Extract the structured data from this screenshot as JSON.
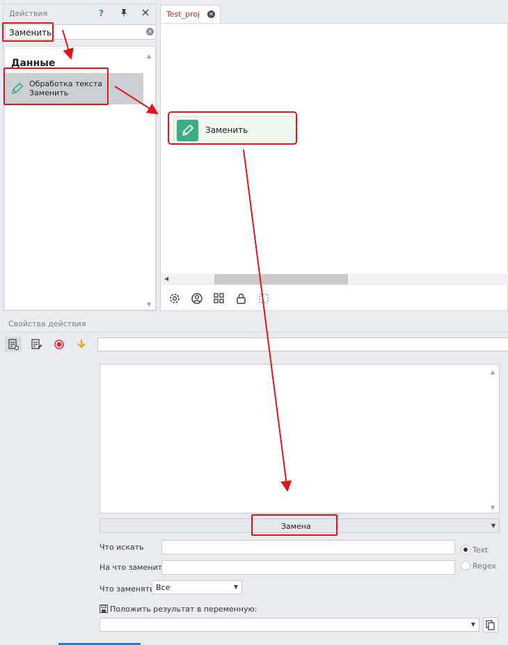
{
  "actions_panel": {
    "title": "Действия",
    "help_icon": "?",
    "search": {
      "value": "Заменить"
    },
    "category": "Данные",
    "item": {
      "line1": "Обработка текста",
      "line2": "Заменить"
    }
  },
  "editor": {
    "tab_label": "Test_proj",
    "node_label": "Заменить",
    "toolbar_icons": [
      "gear-icon",
      "user-circle-icon",
      "grid-icon",
      "lock-icon",
      "selection-icon"
    ]
  },
  "properties": {
    "title": "Свойства действия",
    "mode_value": "Замена",
    "find_label": "Что искать",
    "replace_label": "На что заменить",
    "what_label": "Что заменять",
    "what_value": "Все",
    "radio_text": "Text",
    "radio_regex": "Regex",
    "radio_selected": "Text",
    "save_label": "Положить результат в переменную:"
  },
  "colors": {
    "accent_red": "#e01515",
    "node_green": "#3eaa86",
    "tab_red": "#b2322b"
  }
}
